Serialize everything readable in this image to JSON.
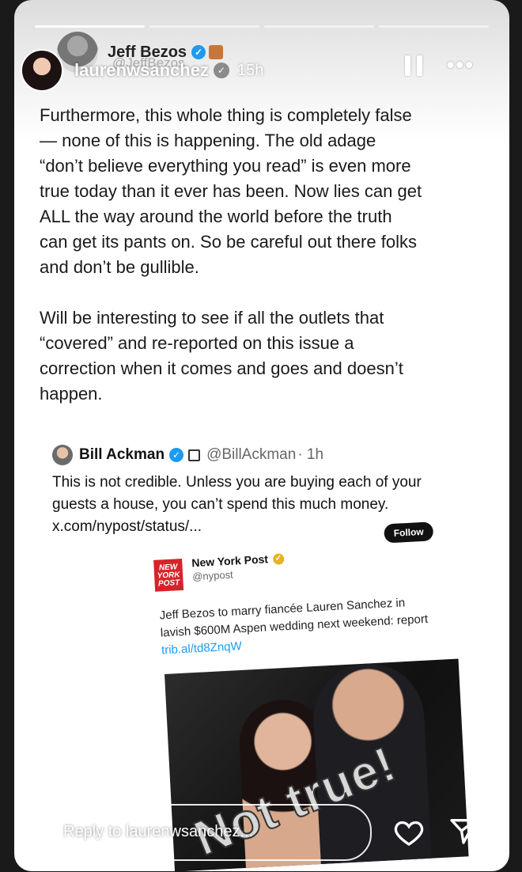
{
  "story": {
    "username": "laurenwsanchez",
    "time": "15h",
    "progress_segments": 4,
    "reply_placeholder": "Reply to laurenwsanchez..."
  },
  "behind_user": {
    "name": "Jeff Bezos",
    "handle": "@JeffBezos"
  },
  "post": {
    "text": "Furthermore, this whole thing is completely false\n— none of this is happening. The old adage\n“don’t believe everything you read” is even more\ntrue today than it ever has been. Now lies can get\nALL the way around the world before the truth\ncan get its pants on. So be careful out there folks\nand don’t be gullible.\n\nWill be interesting to see if all the outlets that\n“covered” and re-reported on this issue a\ncorrection when it comes and goes and doesn’t\nhappen."
  },
  "quote": {
    "name": "Bill Ackman",
    "handle": "@BillAckman",
    "time": "· 1h",
    "text": "This is not credible. Unless you are buying each of your guests a house, you can’t spend this much money. x.com/nypost/status/..."
  },
  "embed": {
    "logo_text": "NEW YORK POST",
    "name": "New York Post",
    "handle": "@nypost",
    "follow_label": "Follow",
    "text": "Jeff Bezos to marry fiancée Lauren Sanchez in lavish $600M Aspen wedding next weekend: report",
    "link": "trib.al/td8ZnqW"
  },
  "sticker": {
    "text": "Not true!"
  },
  "icons": [
    "pause-icon",
    "more-icon",
    "heart-icon",
    "send-icon",
    "verified-badge-icon",
    "business-icon"
  ],
  "colors": {
    "verified": "#1d9bf0",
    "nypost_red": "#d6232a",
    "link": "#1d9bf0"
  }
}
